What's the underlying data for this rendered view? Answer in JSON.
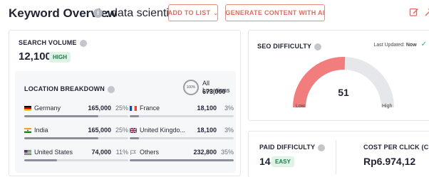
{
  "header": {
    "title": "Keyword Overview",
    "separator": ":",
    "keyword": "data scientist",
    "add_to_list": "ADD TO LIST",
    "generate": "GENERATE CONTENT WITH AI"
  },
  "search_volume": {
    "label": "SEARCH VOLUME",
    "value": "12,100",
    "level": "HIGH"
  },
  "location_breakdown": {
    "label": "LOCATION BREAKDOWN",
    "ring_text": "100%",
    "all_locations_label": "All Locations",
    "all_locations_value": "673,000",
    "rows": [
      {
        "name": "Germany",
        "volume": "165,000",
        "pct": "25%",
        "share": 0.25,
        "flag": "germany-flag-icon"
      },
      {
        "name": "France",
        "volume": "18,100",
        "pct": "3%",
        "share": 0.03,
        "flag": "france-flag-icon"
      },
      {
        "name": "India",
        "volume": "165,000",
        "pct": "25%",
        "share": 0.25,
        "flag": "india-flag-icon"
      },
      {
        "name": "United Kingdo...",
        "volume": "18,100",
        "pct": "3%",
        "share": 0.03,
        "flag": "uk-flag-icon"
      },
      {
        "name": "United States",
        "volume": "74,000",
        "pct": "11%",
        "share": 0.11,
        "flag": "us-flag-icon"
      },
      {
        "name": "Others",
        "volume": "232,800",
        "pct": "35%",
        "share": 0.35,
        "flag": "flag-outline-icon"
      }
    ]
  },
  "seo_difficulty": {
    "label": "SEO DIFFICULTY",
    "last_updated_label": "Last Updated:",
    "last_updated_value": "Now",
    "value": "51",
    "score": 51,
    "low": "Low",
    "high": "High",
    "gauge_color": "#f27d7d",
    "track_color": "#e6e7ea"
  },
  "paid_difficulty": {
    "label": "PAID DIFFICULTY",
    "value": "14",
    "level": "EASY"
  },
  "cpc": {
    "label": "COST PER CLICK (CPC)",
    "value": "Rp6.974,12"
  },
  "colors": {
    "accent": "#e4695d",
    "badge_bg": "#dff4e6",
    "badge_text": "#1f7a4a"
  }
}
